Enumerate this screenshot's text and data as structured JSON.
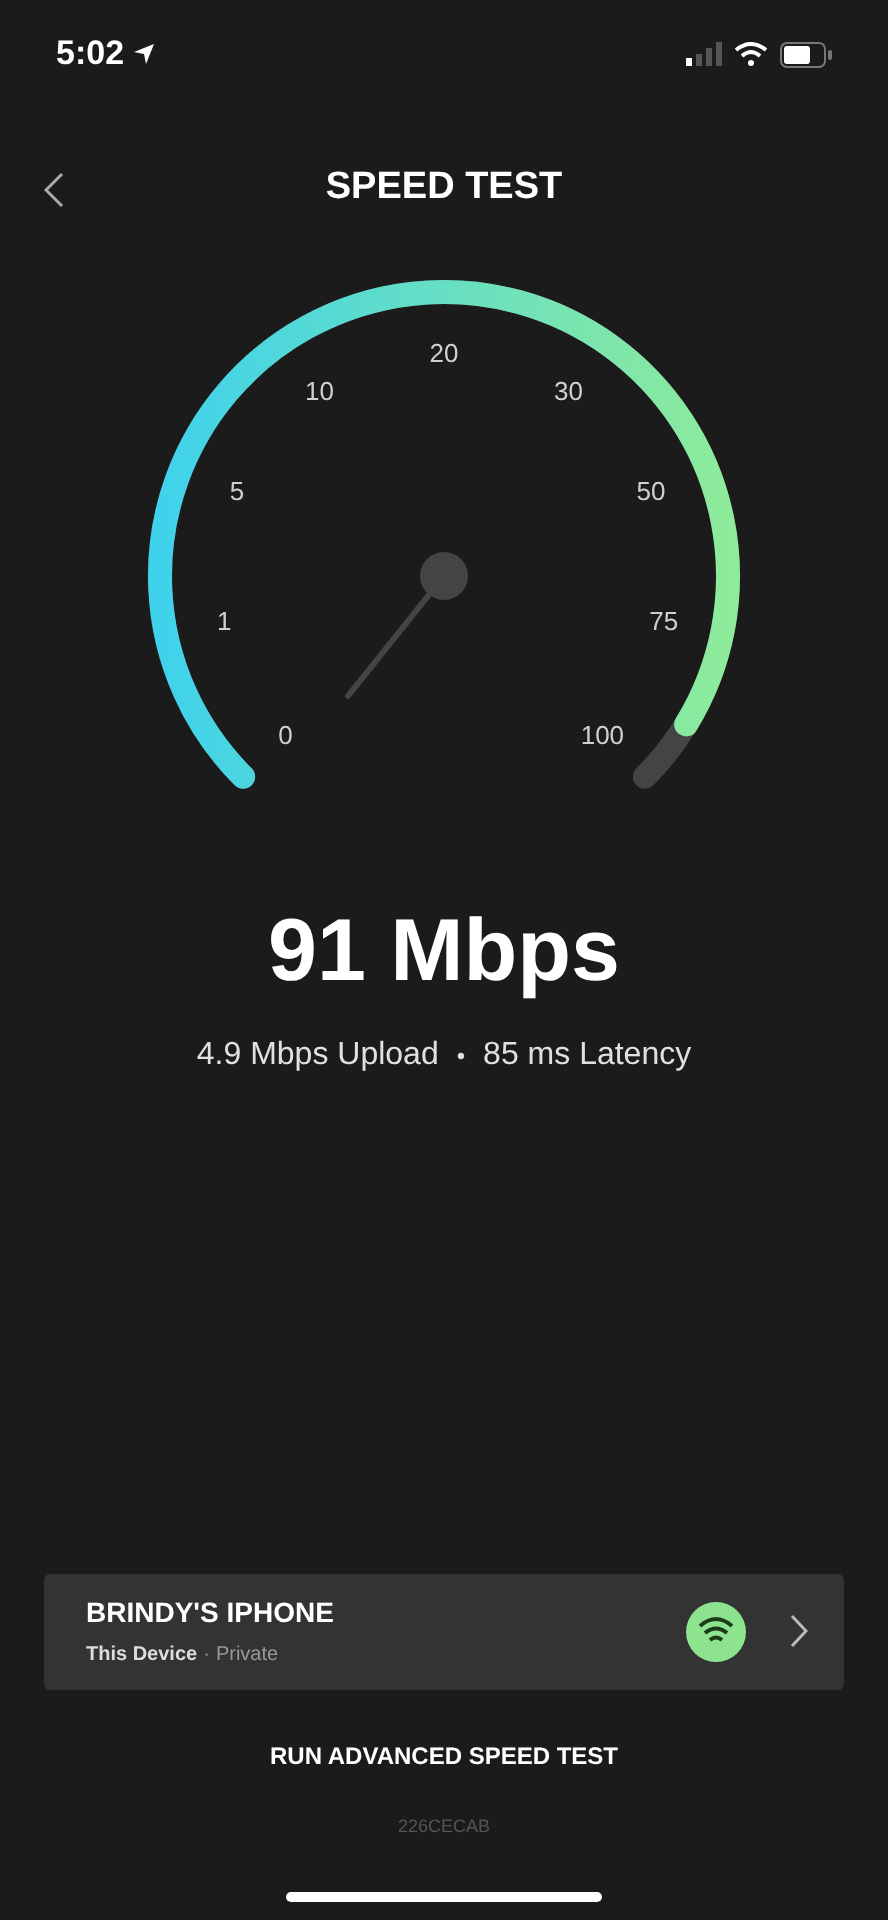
{
  "status_bar": {
    "time": "5:02"
  },
  "header": {
    "title": "SPEED TEST"
  },
  "gauge": {
    "ticks": [
      "0",
      "1",
      "5",
      "10",
      "20",
      "30",
      "50",
      "75",
      "100"
    ]
  },
  "result": {
    "speed": "91 Mbps",
    "upload": "4.9 Mbps Upload",
    "separator": "•",
    "latency": "85 ms Latency"
  },
  "device": {
    "name": "BRINDY'S IPHONE",
    "type": "This Device",
    "separator": "·",
    "privacy": "Private"
  },
  "advanced_button": "RUN ADVANCED SPEED TEST",
  "code": "226CECAB"
}
